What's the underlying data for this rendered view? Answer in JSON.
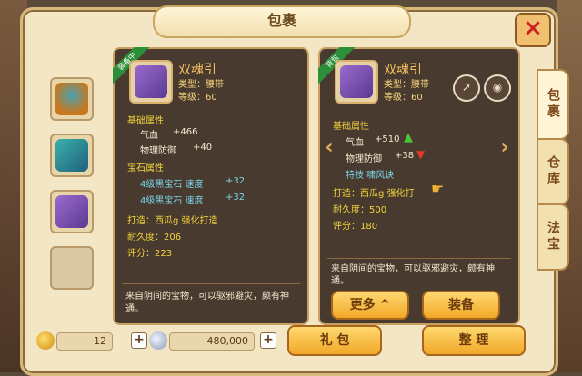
{
  "window": {
    "title": "包裹"
  },
  "tabs": [
    {
      "label": "包裹"
    },
    {
      "label": "仓库"
    },
    {
      "label": "法宝"
    }
  ],
  "equipped": {
    "badge": "装备中",
    "name": "双魂引",
    "type": "类型：腰带",
    "level": "等级：60",
    "base_header": "基础属性",
    "stats": [
      {
        "label": "气血",
        "value": "+466"
      },
      {
        "label": "物理防御",
        "value": "+40"
      }
    ],
    "gem_header": "宝石属性",
    "gems": [
      {
        "label": "4级黑宝石  速度",
        "value": "+32"
      },
      {
        "label": "4级黑宝石  速度",
        "value": "+32"
      }
    ],
    "forge": "打造：西瓜g    强化打造",
    "durability": "耐久度：206",
    "score": "评分：223",
    "desc": "来自阴间的宝物，可以驱邪避灾，颇有神通。"
  },
  "selected": {
    "badge": "背包",
    "name": "双魂引",
    "type": "类型：腰带",
    "level": "等级：60",
    "base_header": "基础属性",
    "stats": [
      {
        "label": "气血",
        "value": "+510",
        "trend": "up"
      },
      {
        "label": "物理防御",
        "value": "+38",
        "trend": "down"
      }
    ],
    "skill": "特技  啸风诀",
    "forge": "打造：西瓜g    强化打",
    "durability": "耐久度：500",
    "score": "评分：180",
    "desc": "来自阴间的宝物，可以驱邪避灾，颇有神通。"
  },
  "buttons": {
    "more": "更多 ^",
    "equip": "装备",
    "gift": "礼 包",
    "sort": "整 理"
  },
  "currency": {
    "coins": "12",
    "silver": "480,000"
  },
  "icons": [
    "helmet-icon",
    "fan-icon",
    "belt-icon",
    "share-icon",
    "eye-icon",
    "close-icon",
    "coin-icon",
    "silver-icon"
  ]
}
